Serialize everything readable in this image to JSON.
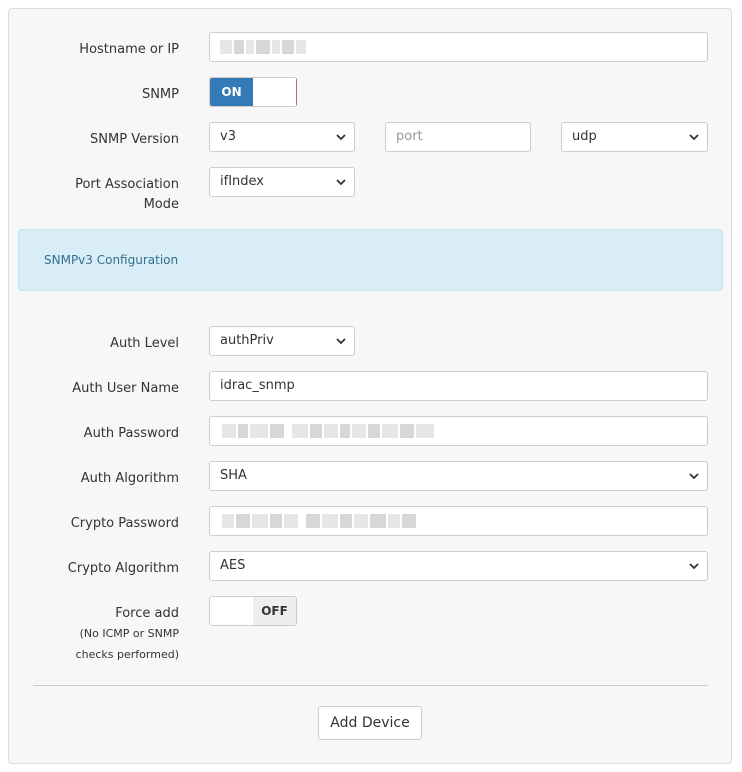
{
  "form": {
    "hostname": {
      "label": "Hostname or IP"
    },
    "snmp": {
      "label": "SNMP",
      "toggle": "ON"
    },
    "snmp_version": {
      "label": "SNMP Version",
      "version": "v3",
      "port_placeholder": "port",
      "transport": "udp"
    },
    "port_assoc": {
      "label_line1": "Port Association",
      "label_line2": "Mode",
      "value": "ifIndex"
    },
    "snmpv3_alert": "SNMPv3 Configuration",
    "auth_level": {
      "label": "Auth Level",
      "value": "authPriv"
    },
    "auth_user": {
      "label": "Auth User Name",
      "value": "idrac_snmp"
    },
    "auth_password": {
      "label": "Auth Password"
    },
    "auth_algorithm": {
      "label": "Auth Algorithm",
      "value": "SHA"
    },
    "crypto_password": {
      "label": "Crypto Password"
    },
    "crypto_algorithm": {
      "label": "Crypto Algorithm",
      "value": "AES"
    },
    "force_add": {
      "label": "Force add",
      "note_line1": "(No ICMP or SNMP",
      "note_line2": "checks performed)",
      "toggle": "OFF"
    },
    "submit": "Add Device"
  }
}
